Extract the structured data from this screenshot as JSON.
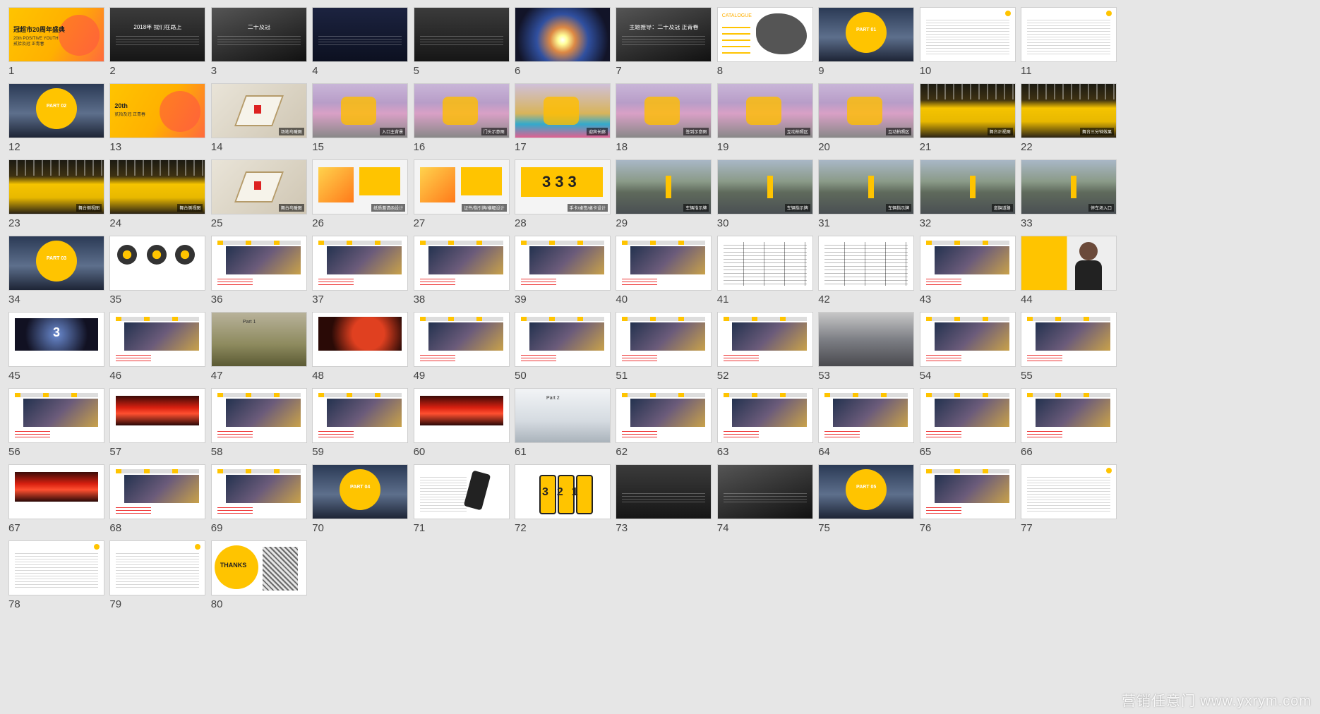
{
  "watermark": "营销任意门 www.yxrym.com",
  "colors": {
    "background": "#e6e6e6",
    "accent_yellow": "#ffc400",
    "brand_orange": "#ff7a1a"
  },
  "slides": [
    {
      "n": "1",
      "kind": "cover",
      "text": "冠超市20周年盛典",
      "sub": "20th POSITIVE YOUTH 贰拾及冠 正青春"
    },
    {
      "n": "2",
      "kind": "dark-text",
      "text": "2018年 我们在路上"
    },
    {
      "n": "3",
      "kind": "dark-photo",
      "text": "二十及冠"
    },
    {
      "n": "4",
      "kind": "navy-text",
      "text": ""
    },
    {
      "n": "5",
      "kind": "dark-text",
      "text": ""
    },
    {
      "n": "6",
      "kind": "light-burst",
      "text": ""
    },
    {
      "n": "7",
      "kind": "dark-photo",
      "text": "主题推导：二十及冠 正青春"
    },
    {
      "n": "8",
      "kind": "map",
      "text": "CATALOGUE"
    },
    {
      "n": "9",
      "kind": "part",
      "text": "PART 01"
    },
    {
      "n": "10",
      "kind": "white-doc",
      "text": ""
    },
    {
      "n": "11",
      "kind": "white-doc",
      "text": ""
    },
    {
      "n": "12",
      "kind": "part",
      "text": "PART 02"
    },
    {
      "n": "13",
      "kind": "cover",
      "text": "20th",
      "sub": "贰拾及冠 正青春"
    },
    {
      "n": "14",
      "kind": "floorplan",
      "text": "场地鸟瞰图"
    },
    {
      "n": "15",
      "kind": "render",
      "text": "入口主背景"
    },
    {
      "n": "16",
      "kind": "render",
      "text": "门头示意图"
    },
    {
      "n": "17",
      "kind": "render-corridor",
      "text": "迎宾长廊"
    },
    {
      "n": "18",
      "kind": "render",
      "text": "签到示意图"
    },
    {
      "n": "19",
      "kind": "render",
      "text": "互动拍照区"
    },
    {
      "n": "20",
      "kind": "render",
      "text": "互动拍照区"
    },
    {
      "n": "21",
      "kind": "stage",
      "text": "舞台正视图"
    },
    {
      "n": "22",
      "kind": "stage",
      "text": "舞台三分钟效果"
    },
    {
      "n": "23",
      "kind": "stage",
      "text": "舞台侧视图"
    },
    {
      "n": "24",
      "kind": "stage",
      "text": "舞台侧视图"
    },
    {
      "n": "25",
      "kind": "floorplan",
      "text": "舞台鸟瞰图"
    },
    {
      "n": "26",
      "kind": "print",
      "text": "纸质邀请函设计"
    },
    {
      "n": "27",
      "kind": "print",
      "text": "证件/指引牌/横幅设计"
    },
    {
      "n": "28",
      "kind": "print-333",
      "text": "手卡/桌签/桌卡设计"
    },
    {
      "n": "29",
      "kind": "road",
      "text": "车辆指示牌"
    },
    {
      "n": "30",
      "kind": "road",
      "text": "车辆指示牌"
    },
    {
      "n": "31",
      "kind": "road",
      "text": "车辆指示牌"
    },
    {
      "n": "32",
      "kind": "road",
      "text": "道旗道路"
    },
    {
      "n": "33",
      "kind": "road",
      "text": "停车场入口"
    },
    {
      "n": "34",
      "kind": "part",
      "text": "PART 03"
    },
    {
      "n": "35",
      "kind": "white-icons",
      "text": ""
    },
    {
      "n": "36",
      "kind": "white-photo",
      "text": ""
    },
    {
      "n": "37",
      "kind": "white-photo",
      "text": ""
    },
    {
      "n": "38",
      "kind": "white-photo",
      "text": ""
    },
    {
      "n": "39",
      "kind": "white-photo",
      "text": ""
    },
    {
      "n": "40",
      "kind": "white-photo",
      "text": ""
    },
    {
      "n": "41",
      "kind": "table",
      "text": ""
    },
    {
      "n": "42",
      "kind": "table",
      "text": ""
    },
    {
      "n": "43",
      "kind": "white-photo",
      "text": ""
    },
    {
      "n": "44",
      "kind": "yellow-person",
      "text": ""
    },
    {
      "n": "45",
      "kind": "countdown",
      "text": "3"
    },
    {
      "n": "46",
      "kind": "white-photo",
      "text": ""
    },
    {
      "n": "47",
      "kind": "nature",
      "text": "Part 1"
    },
    {
      "n": "48",
      "kind": "red-show",
      "text": ""
    },
    {
      "n": "49",
      "kind": "white-photo",
      "text": ""
    },
    {
      "n": "50",
      "kind": "white-photo",
      "text": ""
    },
    {
      "n": "51",
      "kind": "white-photo",
      "text": ""
    },
    {
      "n": "52",
      "kind": "white-photo",
      "text": ""
    },
    {
      "n": "53",
      "kind": "city",
      "text": ""
    },
    {
      "n": "54",
      "kind": "white-photo",
      "text": ""
    },
    {
      "n": "55",
      "kind": "white-photo",
      "text": ""
    },
    {
      "n": "56",
      "kind": "white-photo",
      "text": ""
    },
    {
      "n": "57",
      "kind": "red-stage",
      "text": ""
    },
    {
      "n": "58",
      "kind": "white-photo",
      "text": ""
    },
    {
      "n": "59",
      "kind": "white-photo",
      "text": ""
    },
    {
      "n": "60",
      "kind": "red-stage",
      "text": ""
    },
    {
      "n": "61",
      "kind": "clouds",
      "text": "Part 2"
    },
    {
      "n": "62",
      "kind": "white-photo",
      "text": ""
    },
    {
      "n": "63",
      "kind": "white-photo",
      "text": ""
    },
    {
      "n": "64",
      "kind": "white-photo",
      "text": ""
    },
    {
      "n": "65",
      "kind": "white-photo",
      "text": ""
    },
    {
      "n": "66",
      "kind": "white-photo",
      "text": ""
    },
    {
      "n": "67",
      "kind": "red-stage",
      "text": ""
    },
    {
      "n": "68",
      "kind": "white-photo",
      "text": ""
    },
    {
      "n": "69",
      "kind": "white-photo",
      "text": ""
    },
    {
      "n": "70",
      "kind": "part",
      "text": "PART 04"
    },
    {
      "n": "71",
      "kind": "phone",
      "text": ""
    },
    {
      "n": "72",
      "kind": "phones-321",
      "text": "3 2 1"
    },
    {
      "n": "73",
      "kind": "dark-text",
      "text": ""
    },
    {
      "n": "74",
      "kind": "dark-photo",
      "text": ""
    },
    {
      "n": "75",
      "kind": "part",
      "text": "PART 05"
    },
    {
      "n": "76",
      "kind": "white-photo",
      "text": ""
    },
    {
      "n": "77",
      "kind": "white-doc",
      "text": ""
    },
    {
      "n": "78",
      "kind": "white-doc",
      "text": ""
    },
    {
      "n": "79",
      "kind": "white-doc",
      "text": ""
    },
    {
      "n": "80",
      "kind": "thanks",
      "text": "THANKS"
    }
  ]
}
